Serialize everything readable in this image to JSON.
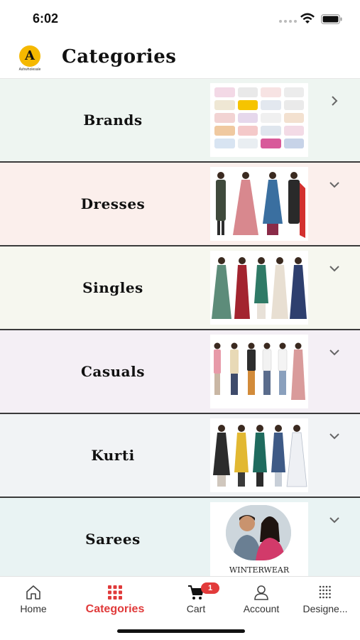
{
  "status_bar": {
    "time": "6:02"
  },
  "header": {
    "logo_text": "A",
    "logo_caption": "Ashwholesale",
    "title": "Categories"
  },
  "categories": [
    {
      "label": "Brands",
      "bg": "#eef5f1",
      "chevron": "chevron-right-icon",
      "thumb": "brand-logos"
    },
    {
      "label": "Dresses",
      "bg": "#fbefec",
      "chevron": "chevron-down-icon",
      "thumb": "models-dresses"
    },
    {
      "label": "Singles",
      "bg": "#f6f7ef",
      "chevron": "chevron-down-icon",
      "thumb": "models-singles"
    },
    {
      "label": "Casuals",
      "bg": "#f4eff5",
      "chevron": "chevron-down-icon",
      "thumb": "models-casuals"
    },
    {
      "label": "Kurti",
      "bg": "#f1f3f5",
      "chevron": "chevron-down-icon",
      "thumb": "models-kurti"
    },
    {
      "label": "Sarees",
      "bg": "#e9f3f3",
      "chevron": "chevron-down-icon",
      "thumb": "winterwear",
      "thumb_caption": "WINTERWEAR"
    }
  ],
  "tab_bar": {
    "items": [
      {
        "label": "Home",
        "icon": "home-icon"
      },
      {
        "label": "Categories",
        "icon": "grid-icon",
        "active": true
      },
      {
        "label": "Cart",
        "icon": "cart-icon",
        "badge": "1"
      },
      {
        "label": "Account",
        "icon": "account-icon"
      },
      {
        "label": "Designe...",
        "icon": "designer-icon"
      }
    ]
  },
  "colors": {
    "accent": "#e03a3a",
    "logo": "#f5b800",
    "divider": "#3a3a3a"
  }
}
